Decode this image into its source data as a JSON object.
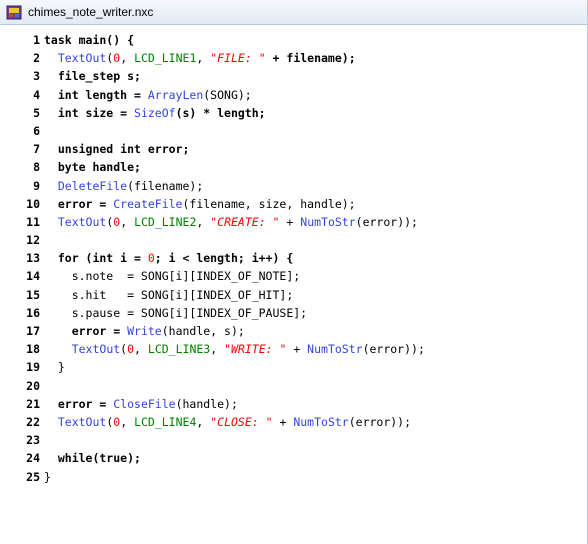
{
  "window": {
    "title": "chimes_note_writer.nxc",
    "icon": "nxc-file-icon"
  },
  "colors": {
    "function": "#3344dd",
    "constant": "#008000",
    "string": "#ff0000",
    "number": "#ff0000",
    "keyword": "#000000"
  },
  "editor": {
    "lines": [
      {
        "num": "1",
        "tokens": [
          {
            "t": "task main() {",
            "c": "kw"
          }
        ]
      },
      {
        "num": "2",
        "tokens": [
          {
            "t": "  ",
            "c": "plain"
          },
          {
            "t": "TextOut",
            "c": "fn"
          },
          {
            "t": "(",
            "c": "plain"
          },
          {
            "t": "0",
            "c": "num"
          },
          {
            "t": ", ",
            "c": "plain"
          },
          {
            "t": "LCD_LINE1",
            "c": "const"
          },
          {
            "t": ", ",
            "c": "plain"
          },
          {
            "t": "\"FILE: \"",
            "c": "str"
          },
          {
            "t": " + filename);",
            "c": "kw"
          }
        ]
      },
      {
        "num": "3",
        "tokens": [
          {
            "t": "  file_step s;",
            "c": "kw"
          }
        ]
      },
      {
        "num": "4",
        "tokens": [
          {
            "t": "  int length = ",
            "c": "kw"
          },
          {
            "t": "ArrayLen",
            "c": "fn"
          },
          {
            "t": "(SONG);",
            "c": "plain"
          }
        ]
      },
      {
        "num": "5",
        "tokens": [
          {
            "t": "  int size = ",
            "c": "kw"
          },
          {
            "t": "SizeOf",
            "c": "fn"
          },
          {
            "t": "(s) * length;",
            "c": "kw"
          }
        ]
      },
      {
        "num": "6",
        "tokens": []
      },
      {
        "num": "7",
        "tokens": [
          {
            "t": "  unsigned int error;",
            "c": "kw"
          }
        ]
      },
      {
        "num": "8",
        "tokens": [
          {
            "t": "  byte handle;",
            "c": "kw"
          }
        ]
      },
      {
        "num": "9",
        "tokens": [
          {
            "t": "  ",
            "c": "plain"
          },
          {
            "t": "DeleteFile",
            "c": "fn"
          },
          {
            "t": "(filename);",
            "c": "plain"
          }
        ]
      },
      {
        "num": "10",
        "tokens": [
          {
            "t": "  error = ",
            "c": "kw"
          },
          {
            "t": "CreateFile",
            "c": "fn"
          },
          {
            "t": "(filename, size, handle);",
            "c": "plain"
          }
        ]
      },
      {
        "num": "11",
        "tokens": [
          {
            "t": "  ",
            "c": "plain"
          },
          {
            "t": "TextOut",
            "c": "fn"
          },
          {
            "t": "(",
            "c": "plain"
          },
          {
            "t": "0",
            "c": "num"
          },
          {
            "t": ", ",
            "c": "plain"
          },
          {
            "t": "LCD_LINE2",
            "c": "const"
          },
          {
            "t": ", ",
            "c": "plain"
          },
          {
            "t": "\"CREATE: \"",
            "c": "str"
          },
          {
            "t": " + ",
            "c": "plain"
          },
          {
            "t": "NumToStr",
            "c": "fn"
          },
          {
            "t": "(error));",
            "c": "plain"
          }
        ]
      },
      {
        "num": "12",
        "tokens": []
      },
      {
        "num": "13",
        "tokens": [
          {
            "t": "  for (int i = ",
            "c": "kw"
          },
          {
            "t": "0",
            "c": "num"
          },
          {
            "t": "; i < length; i++) {",
            "c": "kw"
          }
        ]
      },
      {
        "num": "14",
        "tokens": [
          {
            "t": "    s.note  = SONG[i][INDEX_OF_NOTE];",
            "c": "plain"
          }
        ]
      },
      {
        "num": "15",
        "tokens": [
          {
            "t": "    s.hit   = SONG[i][INDEX_OF_HIT];",
            "c": "plain"
          }
        ]
      },
      {
        "num": "16",
        "tokens": [
          {
            "t": "    s.pause = SONG[i][INDEX_OF_PAUSE];",
            "c": "plain"
          }
        ]
      },
      {
        "num": "17",
        "tokens": [
          {
            "t": "    error = ",
            "c": "kw"
          },
          {
            "t": "Write",
            "c": "fn"
          },
          {
            "t": "(handle, s);",
            "c": "plain"
          }
        ]
      },
      {
        "num": "18",
        "tokens": [
          {
            "t": "    ",
            "c": "plain"
          },
          {
            "t": "TextOut",
            "c": "fn"
          },
          {
            "t": "(",
            "c": "plain"
          },
          {
            "t": "0",
            "c": "num"
          },
          {
            "t": ", ",
            "c": "plain"
          },
          {
            "t": "LCD_LINE3",
            "c": "const"
          },
          {
            "t": ", ",
            "c": "plain"
          },
          {
            "t": "\"WRITE: \"",
            "c": "str"
          },
          {
            "t": " + ",
            "c": "plain"
          },
          {
            "t": "NumToStr",
            "c": "fn"
          },
          {
            "t": "(error));",
            "c": "plain"
          }
        ]
      },
      {
        "num": "19",
        "tokens": [
          {
            "t": "  }",
            "c": "plain"
          }
        ]
      },
      {
        "num": "20",
        "tokens": []
      },
      {
        "num": "21",
        "tokens": [
          {
            "t": "  error = ",
            "c": "kw"
          },
          {
            "t": "CloseFile",
            "c": "fn"
          },
          {
            "t": "(handle);",
            "c": "plain"
          }
        ]
      },
      {
        "num": "22",
        "tokens": [
          {
            "t": "  ",
            "c": "plain"
          },
          {
            "t": "TextOut",
            "c": "fn"
          },
          {
            "t": "(",
            "c": "plain"
          },
          {
            "t": "0",
            "c": "num"
          },
          {
            "t": ", ",
            "c": "plain"
          },
          {
            "t": "LCD_LINE4",
            "c": "const"
          },
          {
            "t": ", ",
            "c": "plain"
          },
          {
            "t": "\"CLOSE: \"",
            "c": "str"
          },
          {
            "t": " + ",
            "c": "plain"
          },
          {
            "t": "NumToStr",
            "c": "fn"
          },
          {
            "t": "(error));",
            "c": "plain"
          }
        ]
      },
      {
        "num": "23",
        "tokens": []
      },
      {
        "num": "24",
        "tokens": [
          {
            "t": "  while(true);",
            "c": "kw"
          }
        ]
      },
      {
        "num": "25",
        "tokens": [
          {
            "t": "}",
            "c": "plain"
          }
        ]
      }
    ]
  }
}
